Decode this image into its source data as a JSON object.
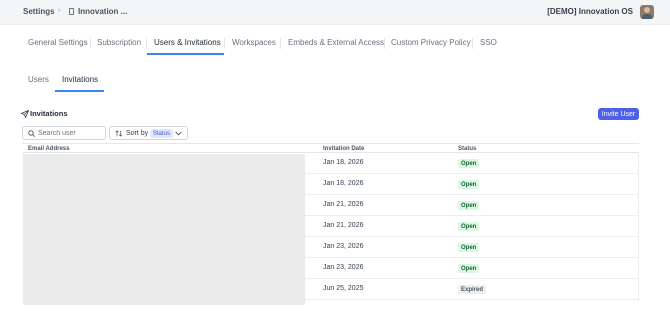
{
  "breadcrumb": {
    "settings": "Settings",
    "separator": "›",
    "current": "Innovation ...",
    "doc_icon": "document-icon"
  },
  "org": {
    "name": "[DEMO] Innovation OS",
    "avatar": "user-avatar"
  },
  "main_tabs": [
    {
      "label": "General Settings",
      "active": false
    },
    {
      "label": "Subscription",
      "active": false
    },
    {
      "label": "Users & Invitations",
      "active": true
    },
    {
      "label": "Workspaces",
      "active": false
    },
    {
      "label": "Embeds & External Access",
      "active": false
    },
    {
      "label": "Custom Privacy Policy",
      "active": false
    },
    {
      "label": "SSO",
      "active": false
    }
  ],
  "sub_tabs": [
    {
      "label": "Users",
      "active": false
    },
    {
      "label": "Invitations",
      "active": true
    }
  ],
  "section": {
    "title": "Invitations",
    "icon": "send-icon",
    "invite_button": "Invite User"
  },
  "search": {
    "placeholder": "Search user",
    "value": ""
  },
  "sort": {
    "label": "Sort by",
    "value": "Status"
  },
  "table": {
    "columns": [
      "Email Address",
      "Invitation Date",
      "Status"
    ],
    "rows": [
      {
        "email": "",
        "date": "Jan 18, 2026",
        "status": "Open"
      },
      {
        "email": "",
        "date": "Jan 18, 2026",
        "status": "Open"
      },
      {
        "email": "",
        "date": "Jan 21, 2026",
        "status": "Open"
      },
      {
        "email": "",
        "date": "Jan 21, 2026",
        "status": "Open"
      },
      {
        "email": "",
        "date": "Jan 23, 2026",
        "status": "Open"
      },
      {
        "email": "",
        "date": "Jan 23, 2026",
        "status": "Open"
      },
      {
        "email": "",
        "date": "Jun 25, 2025",
        "status": "Expired"
      }
    ]
  },
  "colors": {
    "accent": "#3b82f6",
    "button": "#4f5fe6",
    "badge_open_bg": "#dcf7e3",
    "badge_open_text": "#166534",
    "badge_expired_bg": "#eeeeef"
  }
}
